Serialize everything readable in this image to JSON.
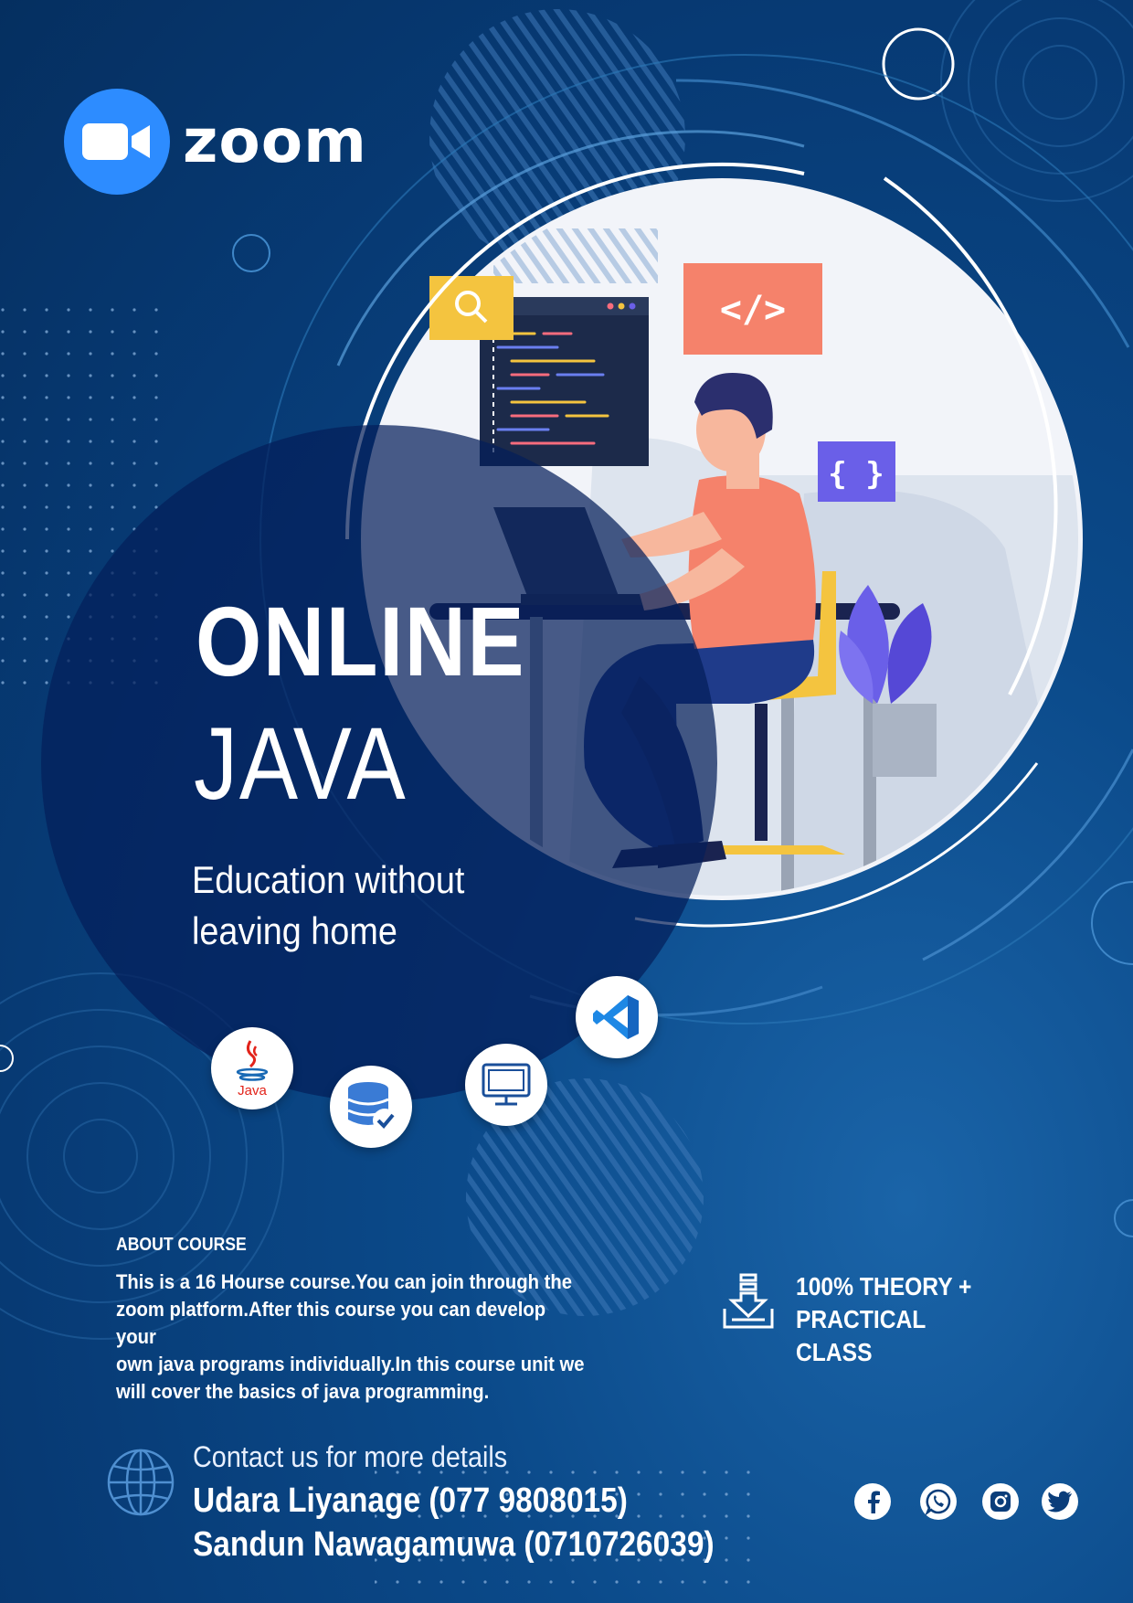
{
  "brand": {
    "name": "zoom",
    "colors": {
      "zoom_blue": "#2D8CFF",
      "background": "#0B4A8A",
      "dark_circle": "#06306A"
    }
  },
  "hero": {
    "line1": "ONLINE",
    "line2": "JAVA",
    "tagline_line1": "Education without",
    "tagline_line2": "leaving home"
  },
  "illustration": {
    "code_tag": "</>",
    "braces": "{ }",
    "java_logo_text": "Java"
  },
  "tech_icons": [
    "java-icon",
    "database-icon",
    "monitor-icon",
    "vscode-icon"
  ],
  "about": {
    "heading": "ABOUT COURSE",
    "lines": [
      "This is a 16 Hourse course.You can join through the",
      "zoom platform.After this course you can develop your",
      "own java programs individually.In this course unit we",
      "will cover the basics of java programming."
    ]
  },
  "feature": {
    "line1": "100% THEORY + PRACTICAL",
    "line2": "CLASS"
  },
  "contact": {
    "heading": "Contact us for more details",
    "person1": "Udara Liyanage  (077 9808015)",
    "person2": "Sandun Nawagamuwa (0710726039)"
  },
  "social_icons": [
    "facebook-icon",
    "whatsapp-icon",
    "instagram-icon",
    "twitter-icon"
  ]
}
